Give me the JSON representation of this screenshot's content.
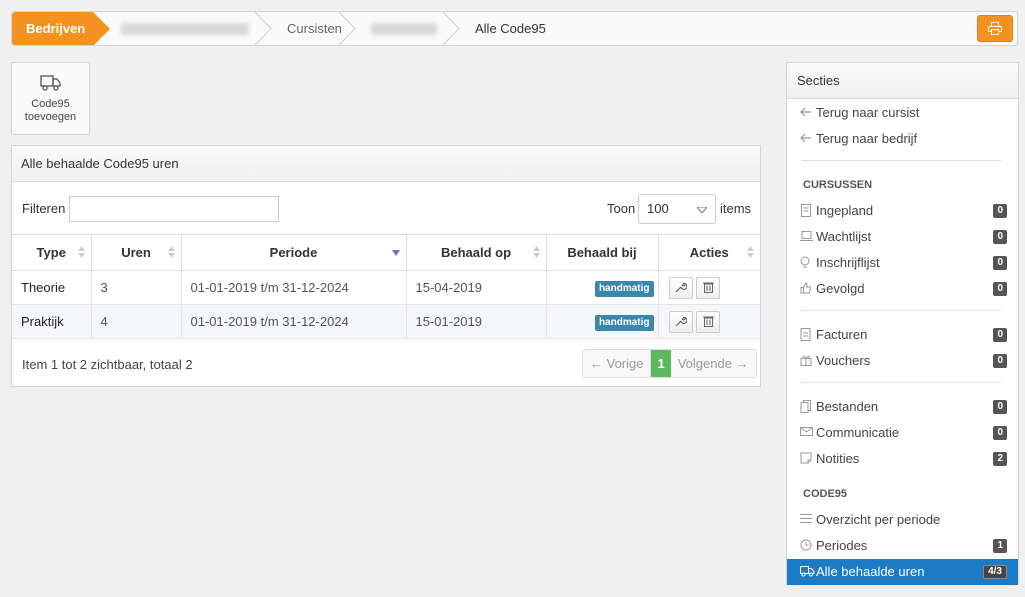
{
  "breadcrumb": {
    "first": "Bedrijven",
    "third": "Cursisten",
    "current": "Alle Code95"
  },
  "add_button": {
    "label_line1": "Code95",
    "label_line2": "toevoegen"
  },
  "panel": {
    "title": "Alle behaalde Code95 uren",
    "filter_label": "Filteren",
    "filter_value": "",
    "toon_label": "Toon",
    "toon_value": "100",
    "items_label": "items",
    "columns": [
      "Type",
      "Uren",
      "Periode",
      "Behaald op",
      "Behaald bij",
      "Acties"
    ],
    "rows": [
      {
        "type": "Theorie",
        "uren": "3",
        "periode": "01-01-2019 t/m 31-12-2024",
        "behaald_op": "15-04-2019",
        "behaald_bij": "handmatig"
      },
      {
        "type": "Praktijk",
        "uren": "4",
        "periode": "01-01-2019 t/m 31-12-2024",
        "behaald_op": "15-01-2019",
        "behaald_bij": "handmatig"
      }
    ],
    "footer_text": "Item 1 tot 2 zichtbaar, totaal 2",
    "pager": {
      "prev": "← Vorige",
      "page": "1",
      "next": "Volgende →"
    }
  },
  "sidebar": {
    "title": "Secties",
    "back_cursist": "Terug naar cursist",
    "back_bedrijf": "Terug naar bedrijf",
    "section_cursussen": "CURSUSSEN",
    "ingepland": {
      "label": "Ingepland",
      "count": "0"
    },
    "wachtlijst": {
      "label": "Wachtlijst",
      "count": "0"
    },
    "inschrijflijst": {
      "label": "Inschrijflijst",
      "count": "0"
    },
    "gevolgd": {
      "label": "Gevolgd",
      "count": "0"
    },
    "facturen": {
      "label": "Facturen",
      "count": "0"
    },
    "vouchers": {
      "label": "Vouchers",
      "count": "0"
    },
    "bestanden": {
      "label": "Bestanden",
      "count": "0"
    },
    "communicatie": {
      "label": "Communicatie",
      "count": "0"
    },
    "notities": {
      "label": "Notities",
      "count": "2"
    },
    "section_code95": "CODE95",
    "overzicht": {
      "label": "Overzicht per periode"
    },
    "periodes": {
      "label": "Periodes",
      "count": "1"
    },
    "alle_uren": {
      "label": "Alle behaalde uren",
      "count": "4/3"
    }
  },
  "colors": {
    "accent": "#f39221",
    "active": "#1c7bc4",
    "badge": "#3a87ad",
    "pager_active": "#5cb85c"
  }
}
